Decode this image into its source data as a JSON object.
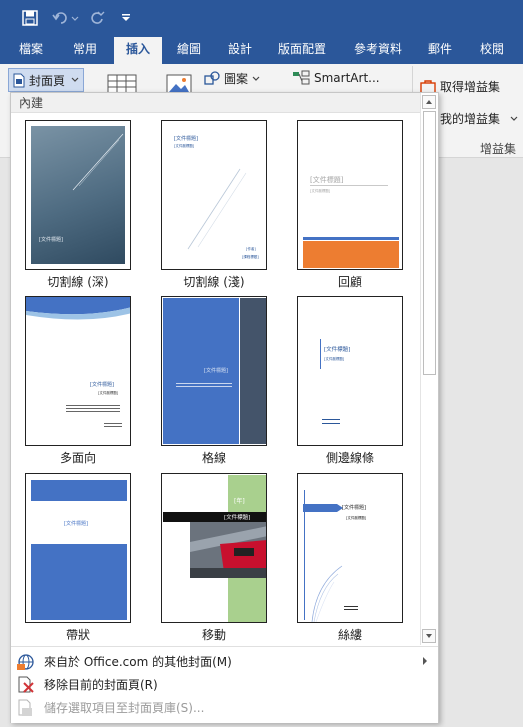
{
  "tabs": [
    "檔案",
    "常用",
    "插入",
    "繪圖",
    "設計",
    "版面配置",
    "參考資料",
    "郵件",
    "校閱"
  ],
  "active_tab": "插入",
  "ribbon": {
    "cover_page_label": "封面頁",
    "shapes_label": "圖案",
    "smartart_label": "SmartArt...",
    "get_addins_label": "取得增益集",
    "my_addins_label": "我的增益集",
    "addins_group_label": "增益集"
  },
  "gallery": {
    "section_title": "內建",
    "covers": [
      {
        "label": "切割線 (深)",
        "title": "[文件標題]"
      },
      {
        "label": "切割線 (淺)",
        "title": "[文件標題]",
        "subtitle": "[文件副標題]",
        "meta1": "[作者]",
        "meta2": "[課程標題]"
      },
      {
        "label": "回顧",
        "title": "[文件標題]",
        "subtitle": "[文件副標題]"
      },
      {
        "label": "多面向",
        "title": "[文件標題]",
        "subtitle": "[文件副標題]"
      },
      {
        "label": "格線",
        "title": "[文件標題]"
      },
      {
        "label": "側邊線條",
        "title": "[文件標題]",
        "subtitle": "[文件副標題]"
      },
      {
        "label": "帶狀",
        "title": "[文件標題]"
      },
      {
        "label": "移動",
        "title": "[文件標題]",
        "year": "[年]"
      },
      {
        "label": "絲縷",
        "title": "[文件標題]",
        "subtitle": "[文件副標題]"
      }
    ]
  },
  "menu": [
    {
      "label": "來自於 Office.com 的其他封面(M)",
      "icon": "office-covers-icon",
      "enabled": true
    },
    {
      "label": "移除目前的封面頁(R)",
      "icon": "remove-cover-icon",
      "enabled": true
    },
    {
      "label": "儲存選取項目至封面頁庫(S)...",
      "icon": "save-selection-icon",
      "enabled": false
    }
  ],
  "colors": {
    "title_bar": "#2b579a",
    "accent_blue": "#4472c4",
    "accent_orange": "#ed7d31",
    "accent_green": "#a9d08e"
  }
}
